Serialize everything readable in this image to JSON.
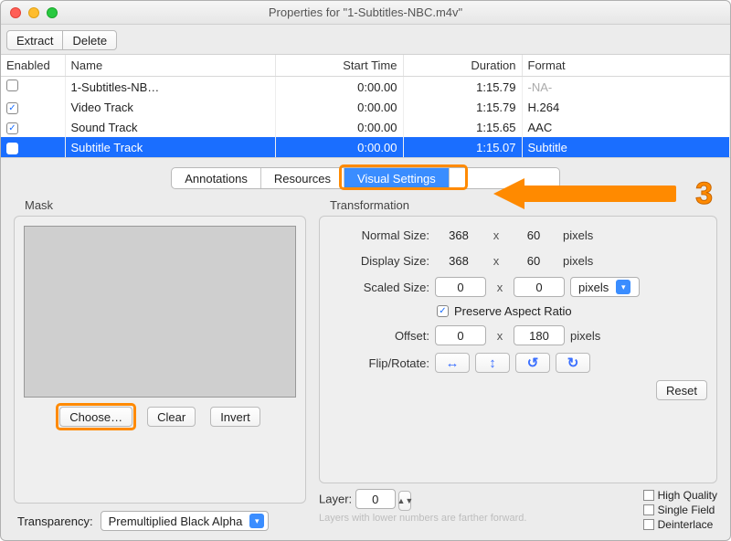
{
  "window": {
    "title": "Properties for \"1-Subtitles-NBC.m4v\""
  },
  "toolbar": {
    "extract": "Extract",
    "delete": "Delete"
  },
  "table": {
    "headers": {
      "enabled": "Enabled",
      "name": "Name",
      "start": "Start Time",
      "duration": "Duration",
      "format": "Format"
    },
    "rows": [
      {
        "enabled": false,
        "name": "1-Subtitles-NB…",
        "start": "0:00.00",
        "duration": "1:15.79",
        "format": "-NA-",
        "na": true
      },
      {
        "enabled": true,
        "name": "Video Track",
        "start": "0:00.00",
        "duration": "1:15.79",
        "format": "H.264"
      },
      {
        "enabled": true,
        "name": "Sound Track",
        "start": "0:00.00",
        "duration": "1:15.65",
        "format": "AAC"
      },
      {
        "enabled": true,
        "name": "Subtitle Track",
        "start": "0:00.00",
        "duration": "1:15.07",
        "format": "Subtitle",
        "selected": true
      }
    ]
  },
  "tabs": {
    "annotations": "Annotations",
    "resources": "Resources",
    "visual": "Visual Settings"
  },
  "step": "3",
  "mask": {
    "title": "Mask",
    "choose": "Choose…",
    "clear": "Clear",
    "invert": "Invert"
  },
  "transparency": {
    "label": "Transparency:",
    "value": "Premultiplied Black Alpha"
  },
  "transform": {
    "title": "Transformation",
    "normal_label": "Normal Size:",
    "normal_w": "368",
    "normal_h": "60",
    "display_label": "Display Size:",
    "display_w": "368",
    "display_h": "60",
    "scaled_label": "Scaled Size:",
    "scaled_w": "0",
    "scaled_h": "0",
    "scaled_unit": "pixels",
    "preserve": "Preserve Aspect Ratio",
    "offset_label": "Offset:",
    "offset_x": "0",
    "offset_y": "180",
    "flip_label": "Flip/Rotate:",
    "reset": "Reset",
    "x": "x",
    "pixels": "pixels"
  },
  "layer": {
    "label": "Layer:",
    "value": "0",
    "hint": "Layers with lower numbers are farther forward."
  },
  "checks": {
    "hq": "High Quality",
    "sf": "Single Field",
    "de": "Deinterlace"
  }
}
